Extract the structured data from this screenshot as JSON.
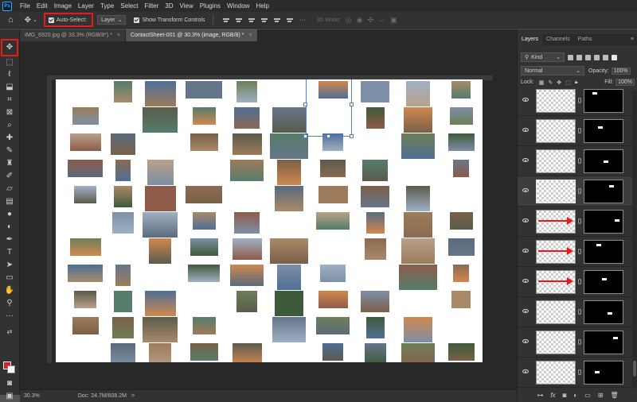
{
  "menubar": {
    "logo": "Ps",
    "items": [
      "File",
      "Edit",
      "Image",
      "Layer",
      "Type",
      "Select",
      "Filter",
      "3D",
      "View",
      "Plugins",
      "Window",
      "Help"
    ]
  },
  "options": {
    "auto_select_label": "Auto-Select:",
    "auto_select_target": "Layer",
    "show_transform_label": "Show Transform Controls",
    "mode_3d_label": "3D Mode:"
  },
  "tabs": [
    {
      "label": "IMG_6920.jpg @ 33.3% (RGB/8*) *",
      "close": "×"
    },
    {
      "label": "ContactSheet-001 @ 30.3% (image, RGB/8) *",
      "close": "×"
    }
  ],
  "status": {
    "zoom": "30.3%",
    "doc": "Doc: 24.7M/608.2M",
    "arrow": ">"
  },
  "panel": {
    "tabs": [
      "Layers",
      "Channels",
      "Paths"
    ],
    "filter_kind": "Kind",
    "blend_mode": "Normal",
    "opacity_label": "Opacity:",
    "opacity_value": "100%",
    "lock_label": "Lock:",
    "fill_label": "Fill:",
    "fill_value": "100%",
    "footer_icons": [
      "link-layers-icon",
      "fx-icon",
      "add-mask-icon",
      "adjustment-icon",
      "group-icon",
      "new-layer-icon",
      "delete-icon"
    ]
  },
  "colors": {
    "highlight": "#e21b1b",
    "selection": "#4f78e0",
    "foreground": "#e21b1b",
    "background": "#ffffff"
  }
}
